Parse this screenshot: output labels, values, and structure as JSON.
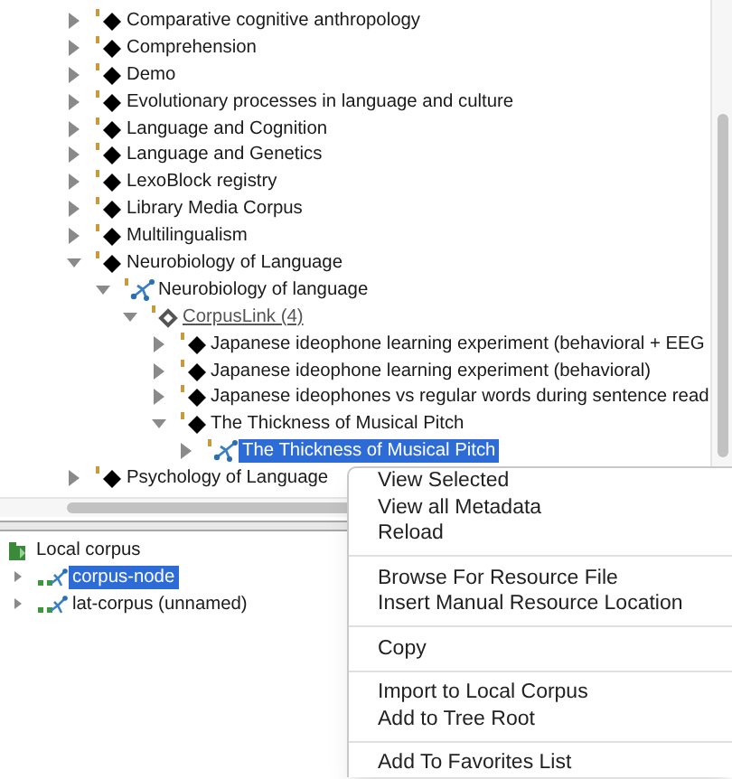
{
  "remote_tree": {
    "items": [
      {
        "label": "Comparative cognitive anthropology",
        "kind": "node",
        "expanded": false,
        "selected": false
      },
      {
        "label": "Comprehension",
        "kind": "node",
        "expanded": false,
        "selected": false
      },
      {
        "label": "Demo",
        "kind": "node",
        "expanded": false,
        "selected": false
      },
      {
        "label": "Evolutionary processes in language and culture",
        "kind": "node",
        "expanded": false,
        "selected": false
      },
      {
        "label": "Language and Cognition",
        "kind": "node",
        "expanded": false,
        "selected": false
      },
      {
        "label": "Language and Genetics",
        "kind": "node",
        "expanded": false,
        "selected": false
      },
      {
        "label": "LexoBlock registry",
        "kind": "node",
        "expanded": false,
        "selected": false
      },
      {
        "label": "Library Media Corpus",
        "kind": "node",
        "expanded": false,
        "selected": false
      },
      {
        "label": "Multilingualism",
        "kind": "node",
        "expanded": false,
        "selected": false
      },
      {
        "label": "Neurobiology of Language",
        "kind": "node",
        "expanded": true,
        "selected": false,
        "children": [
          {
            "label": "Neurobiology of language",
            "kind": "corpus",
            "expanded": true,
            "selected": false,
            "children": [
              {
                "label": "CorpusLink (4)",
                "kind": "link",
                "expanded": true,
                "selected": false,
                "children": [
                  {
                    "label": "Japanese ideophone learning experiment (behavioral + EEG",
                    "kind": "node",
                    "expanded": false,
                    "selected": false
                  },
                  {
                    "label": "Japanese ideophone learning experiment (behavioral)",
                    "kind": "node",
                    "expanded": false,
                    "selected": false
                  },
                  {
                    "label": "Japanese ideophones vs regular words during sentence read",
                    "kind": "node",
                    "expanded": false,
                    "selected": false
                  },
                  {
                    "label": "The Thickness of Musical Pitch",
                    "kind": "node",
                    "expanded": true,
                    "selected": false,
                    "children": [
                      {
                        "label": "The Thickness of Musical Pitch",
                        "kind": "corpus",
                        "expanded": false,
                        "selected": true
                      }
                    ]
                  }
                ]
              }
            ]
          }
        ]
      },
      {
        "label": "Psychology of Language",
        "kind": "node",
        "expanded": false,
        "selected": false
      }
    ]
  },
  "local_tree": {
    "items": [
      {
        "label": "Local corpus",
        "kind": "folder",
        "selected": false,
        "children": [
          {
            "label": "corpus-node",
            "kind": "local",
            "expanded": false,
            "selected": true
          },
          {
            "label": "lat-corpus (unnamed)",
            "kind": "local",
            "expanded": false,
            "selected": false
          }
        ]
      }
    ]
  },
  "context_menu": {
    "groups": [
      [
        "View Selected",
        "View all Metadata",
        "Reload"
      ],
      [
        "Browse For Resource File",
        "Insert Manual Resource Location"
      ],
      [
        "Copy"
      ],
      [
        "Import to Local Corpus",
        "Add to Tree Root"
      ],
      [
        "Add To Favorites List"
      ]
    ]
  }
}
